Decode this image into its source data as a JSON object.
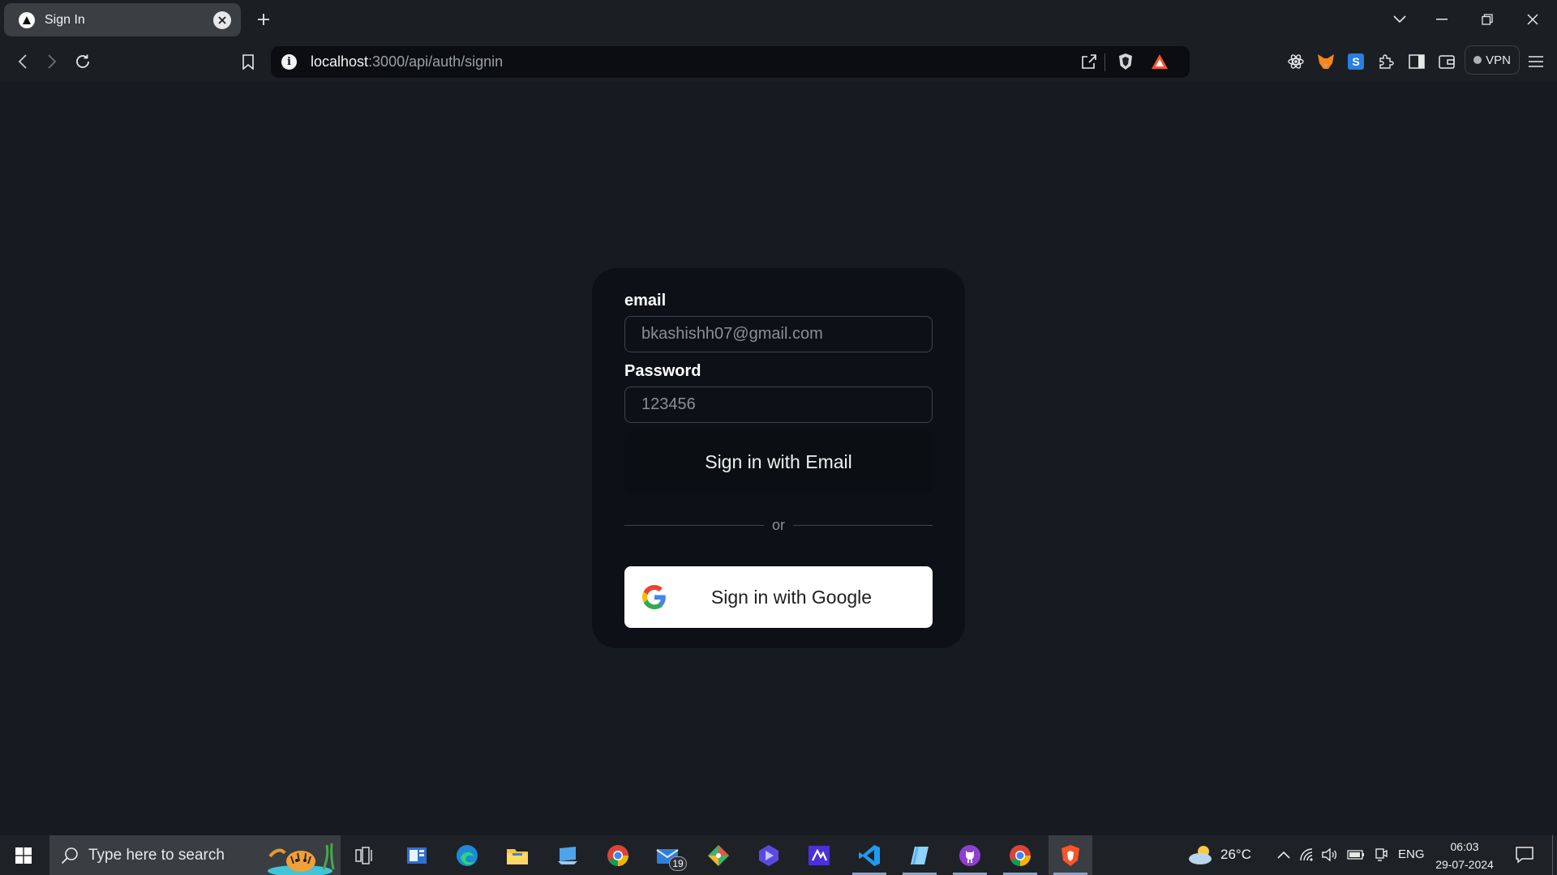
{
  "browser": {
    "tab": {
      "title": "Sign In"
    },
    "address": {
      "host": "localhost",
      "path": ":3000/api/auth/signin"
    },
    "vpn_label": "VPN"
  },
  "signin": {
    "email_label": "email",
    "email_placeholder": "bkashishh07@gmail.com",
    "password_label": "Password",
    "password_placeholder": "123456",
    "email_button": "Sign in with Email",
    "divider_text": "or",
    "google_button": "Sign in with Google"
  },
  "taskbar": {
    "search_placeholder": "Type here to search",
    "mail_badge": "19",
    "weather": "26°C",
    "language": "ENG",
    "time": "06:03",
    "date": "29-07-2024"
  },
  "colors": {
    "page_bg": "#161b22",
    "card_bg": "#0d1117",
    "brave_orange": "#fb542b"
  }
}
